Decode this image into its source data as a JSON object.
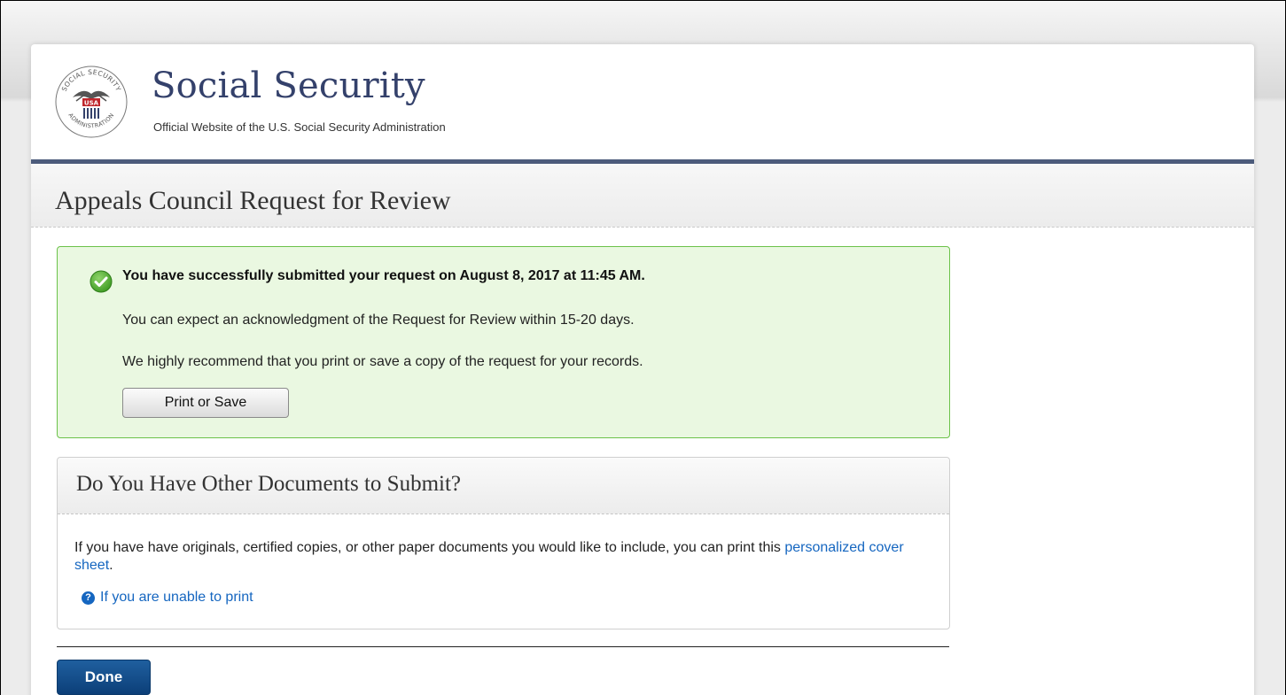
{
  "header": {
    "brand_title": "Social Security",
    "brand_subtitle": "Official Website of the U.S. Social Security Administration",
    "seal_text_top": "SOCIAL SECURITY",
    "seal_text_bottom": "ADMINISTRATION",
    "seal_badge": "USA"
  },
  "page": {
    "title": "Appeals Council Request for Review"
  },
  "success": {
    "icon": "check-circle-icon",
    "heading": "You have successfully submitted your request on August 8, 2017 at 11:45 AM.",
    "line1": "You can expect an acknowledgment of the Request for Review within 15-20 days.",
    "line2": "We highly recommend that you print or save a copy of the request for your records.",
    "print_button_label": "Print or Save"
  },
  "documents": {
    "title": "Do You Have Other Documents to Submit?",
    "body_text": "If you have have originals, certified copies, or other paper documents you would like to include, you can print this ",
    "cover_sheet_link": "personalized cover sheet",
    "body_end": ".",
    "help_icon": "question-circle-icon",
    "help_link": "If you are unable to print"
  },
  "footer": {
    "done_label": "Done"
  },
  "colors": {
    "brand_navy": "#34416b",
    "header_rule": "#4c5b7b",
    "success_bg": "#eaf8e1",
    "success_border": "#6cc24a",
    "link": "#1566c0",
    "done_button": "#0c3f78"
  }
}
